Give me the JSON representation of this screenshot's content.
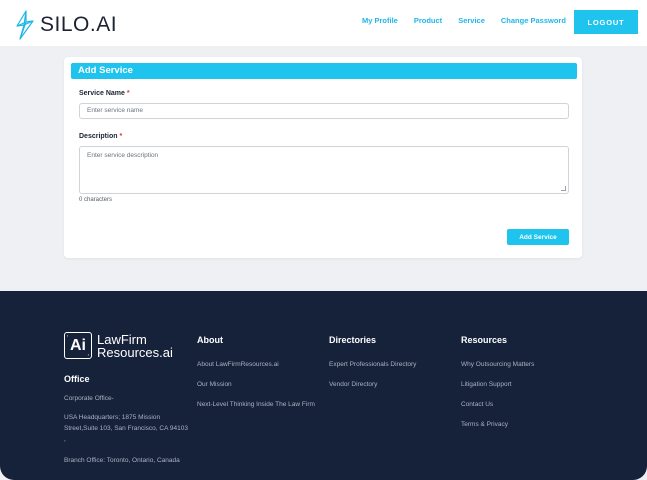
{
  "header": {
    "brand": "SILO.AI",
    "nav": [
      "My Profile",
      "Product",
      "Service",
      "Change Password"
    ],
    "logout": "LOGOUT"
  },
  "form": {
    "title": "Add Service",
    "name_label": "Service Name",
    "name_placeholder": "Enter service name",
    "desc_label": "Description",
    "desc_placeholder": "Enter service description",
    "char_count": "0 characters",
    "submit": "Add Service",
    "required_mark": "*"
  },
  "footer": {
    "brand_line1": "LawFirm",
    "brand_line2": "Resources.ai",
    "logo_text": "Ai",
    "office_heading": "Office",
    "office_items": [
      "Corporate Office-",
      "USA Headquarters; 1875 Mission Street,Suite 103, San Francisco, CA 94103 ,",
      "Branch Office: Toronto, Ontario, Canada"
    ],
    "about_heading": "About",
    "about_items": [
      "About LawFirmResources.ai",
      "Our Mission",
      "Next-Level Thinking Inside The Law Firm"
    ],
    "directories_heading": "Directories",
    "directories_items": [
      "Expert Professionals Directory",
      "Vendor Directory"
    ],
    "resources_heading": "Resources",
    "resources_items": [
      "Why Outsourcing Matters",
      "Litigation Support",
      "Contact Us",
      "Terms & Privacy"
    ]
  }
}
